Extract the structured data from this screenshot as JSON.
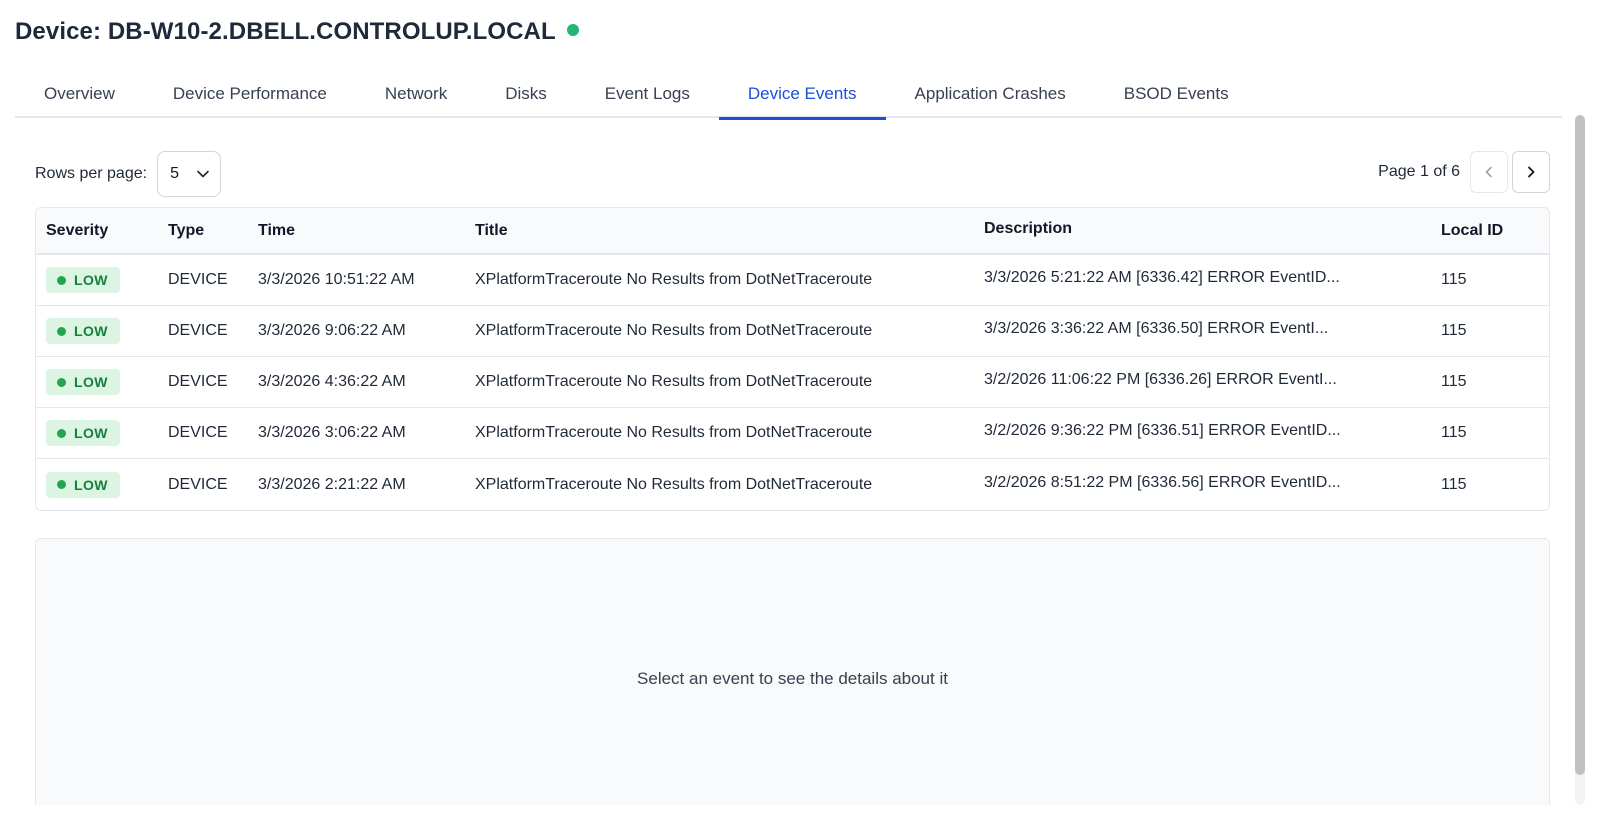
{
  "header": {
    "title": "Device: DB-W10-2.DBELL.CONTROLUP.LOCAL",
    "status_color": "#22b573"
  },
  "tabs": [
    {
      "label": "Overview",
      "active": false
    },
    {
      "label": "Device Performance",
      "active": false
    },
    {
      "label": "Network",
      "active": false
    },
    {
      "label": "Disks",
      "active": false
    },
    {
      "label": "Event Logs",
      "active": false
    },
    {
      "label": "Device Events",
      "active": true
    },
    {
      "label": "Application Crashes",
      "active": false
    },
    {
      "label": "BSOD Events",
      "active": false
    }
  ],
  "pagination": {
    "rows_label": "Rows per page:",
    "rows_value": "5",
    "page_text": "Page 1 of 6"
  },
  "table": {
    "columns": [
      "Severity",
      "Type",
      "Time",
      "Title",
      "Description",
      "Local ID"
    ],
    "rows": [
      {
        "severity": "LOW",
        "type": "DEVICE",
        "time": "3/3/2026 10:51:22 AM",
        "title": "XPlatformTraceroute No Results from DotNetTraceroute",
        "description": "3/3/2026 5:21:22 AM [6336.42] ERROR EventID...",
        "local_id": "115"
      },
      {
        "severity": "LOW",
        "type": "DEVICE",
        "time": "3/3/2026 9:06:22 AM",
        "title": "XPlatformTraceroute No Results from DotNetTraceroute",
        "description": "3/3/2026 3:36:22 AM [6336.50] ERROR EventI...",
        "local_id": "115"
      },
      {
        "severity": "LOW",
        "type": "DEVICE",
        "time": "3/3/2026 4:36:22 AM",
        "title": "XPlatformTraceroute No Results from DotNetTraceroute",
        "description": "3/2/2026 11:06:22 PM [6336.26] ERROR EventI...",
        "local_id": "115"
      },
      {
        "severity": "LOW",
        "type": "DEVICE",
        "time": "3/3/2026 3:06:22 AM",
        "title": "XPlatformTraceroute No Results from DotNetTraceroute",
        "description": "3/2/2026 9:36:22 PM [6336.51] ERROR EventID...",
        "local_id": "115"
      },
      {
        "severity": "LOW",
        "type": "DEVICE",
        "time": "3/3/2026 2:21:22 AM",
        "title": "XPlatformTraceroute No Results from DotNetTraceroute",
        "description": "3/2/2026 8:51:22 PM [6336.56] ERROR EventID...",
        "local_id": "115"
      }
    ]
  },
  "details": {
    "placeholder": "Select an event to see the details about it"
  },
  "colors": {
    "accent": "#1d4ed8",
    "low_badge_bg": "#dcf5e3",
    "low_badge_text": "#15803d"
  }
}
